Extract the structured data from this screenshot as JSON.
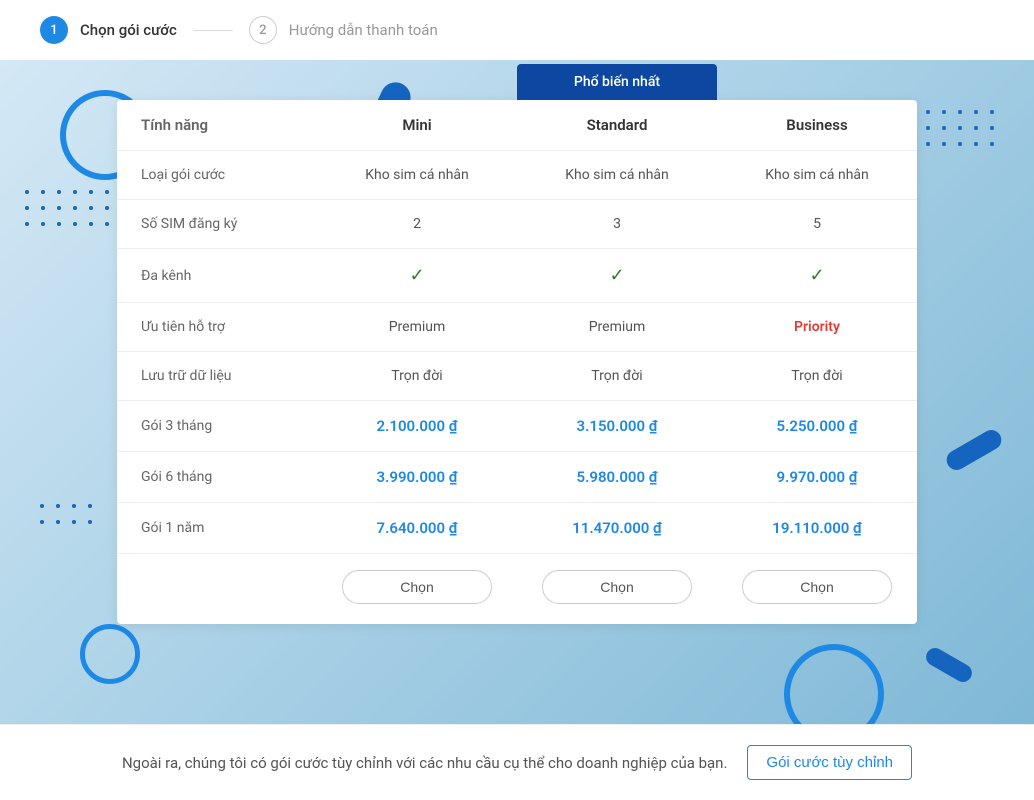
{
  "stepper": {
    "step1": {
      "number": "1",
      "label": "Chọn gói cước"
    },
    "step2": {
      "number": "2",
      "label": "Hướng dẫn thanh toán"
    }
  },
  "pricing": {
    "popular_badge": "Phổ biến nhất",
    "headers": {
      "feature": "Tính năng",
      "plan0": "Mini",
      "plan1": "Standard",
      "plan2": "Business"
    },
    "rows": {
      "package_type": {
        "label": "Loại gói cước",
        "v0": "Kho sim cá nhân",
        "v1": "Kho sim cá nhân",
        "v2": "Kho sim cá nhân"
      },
      "sim_count": {
        "label": "Số SIM đăng ký",
        "v0": "2",
        "v1": "3",
        "v2": "5"
      },
      "multichannel": {
        "label": "Đa kênh"
      },
      "support": {
        "label": "Ưu tiên hỗ trợ",
        "v0": "Premium",
        "v1": "Premium",
        "v2": "Priority"
      },
      "storage": {
        "label": "Lưu trữ dữ liệu",
        "v0": "Trọn đời",
        "v1": "Trọn đời",
        "v2": "Trọn đời"
      },
      "price3m": {
        "label": "Gói 3 tháng",
        "v0": "2.100.000 ₫",
        "v1": "3.150.000 ₫",
        "v2": "5.250.000 ₫"
      },
      "price6m": {
        "label": "Gói 6 tháng",
        "v0": "3.990.000 ₫",
        "v1": "5.980.000 ₫",
        "v2": "9.970.000 ₫"
      },
      "price12m": {
        "label": "Gói 1 năm",
        "v0": "7.640.000 ₫",
        "v1": "11.470.000 ₫",
        "v2": "19.110.000 ₫"
      }
    },
    "select_label": "Chọn"
  },
  "footer": {
    "text": "Ngoài ra, chúng tôi có gói cước tùy chỉnh với các nhu cầu cụ thể cho doanh nghiệp của bạn.",
    "button": "Gói cước tùy chỉnh"
  }
}
